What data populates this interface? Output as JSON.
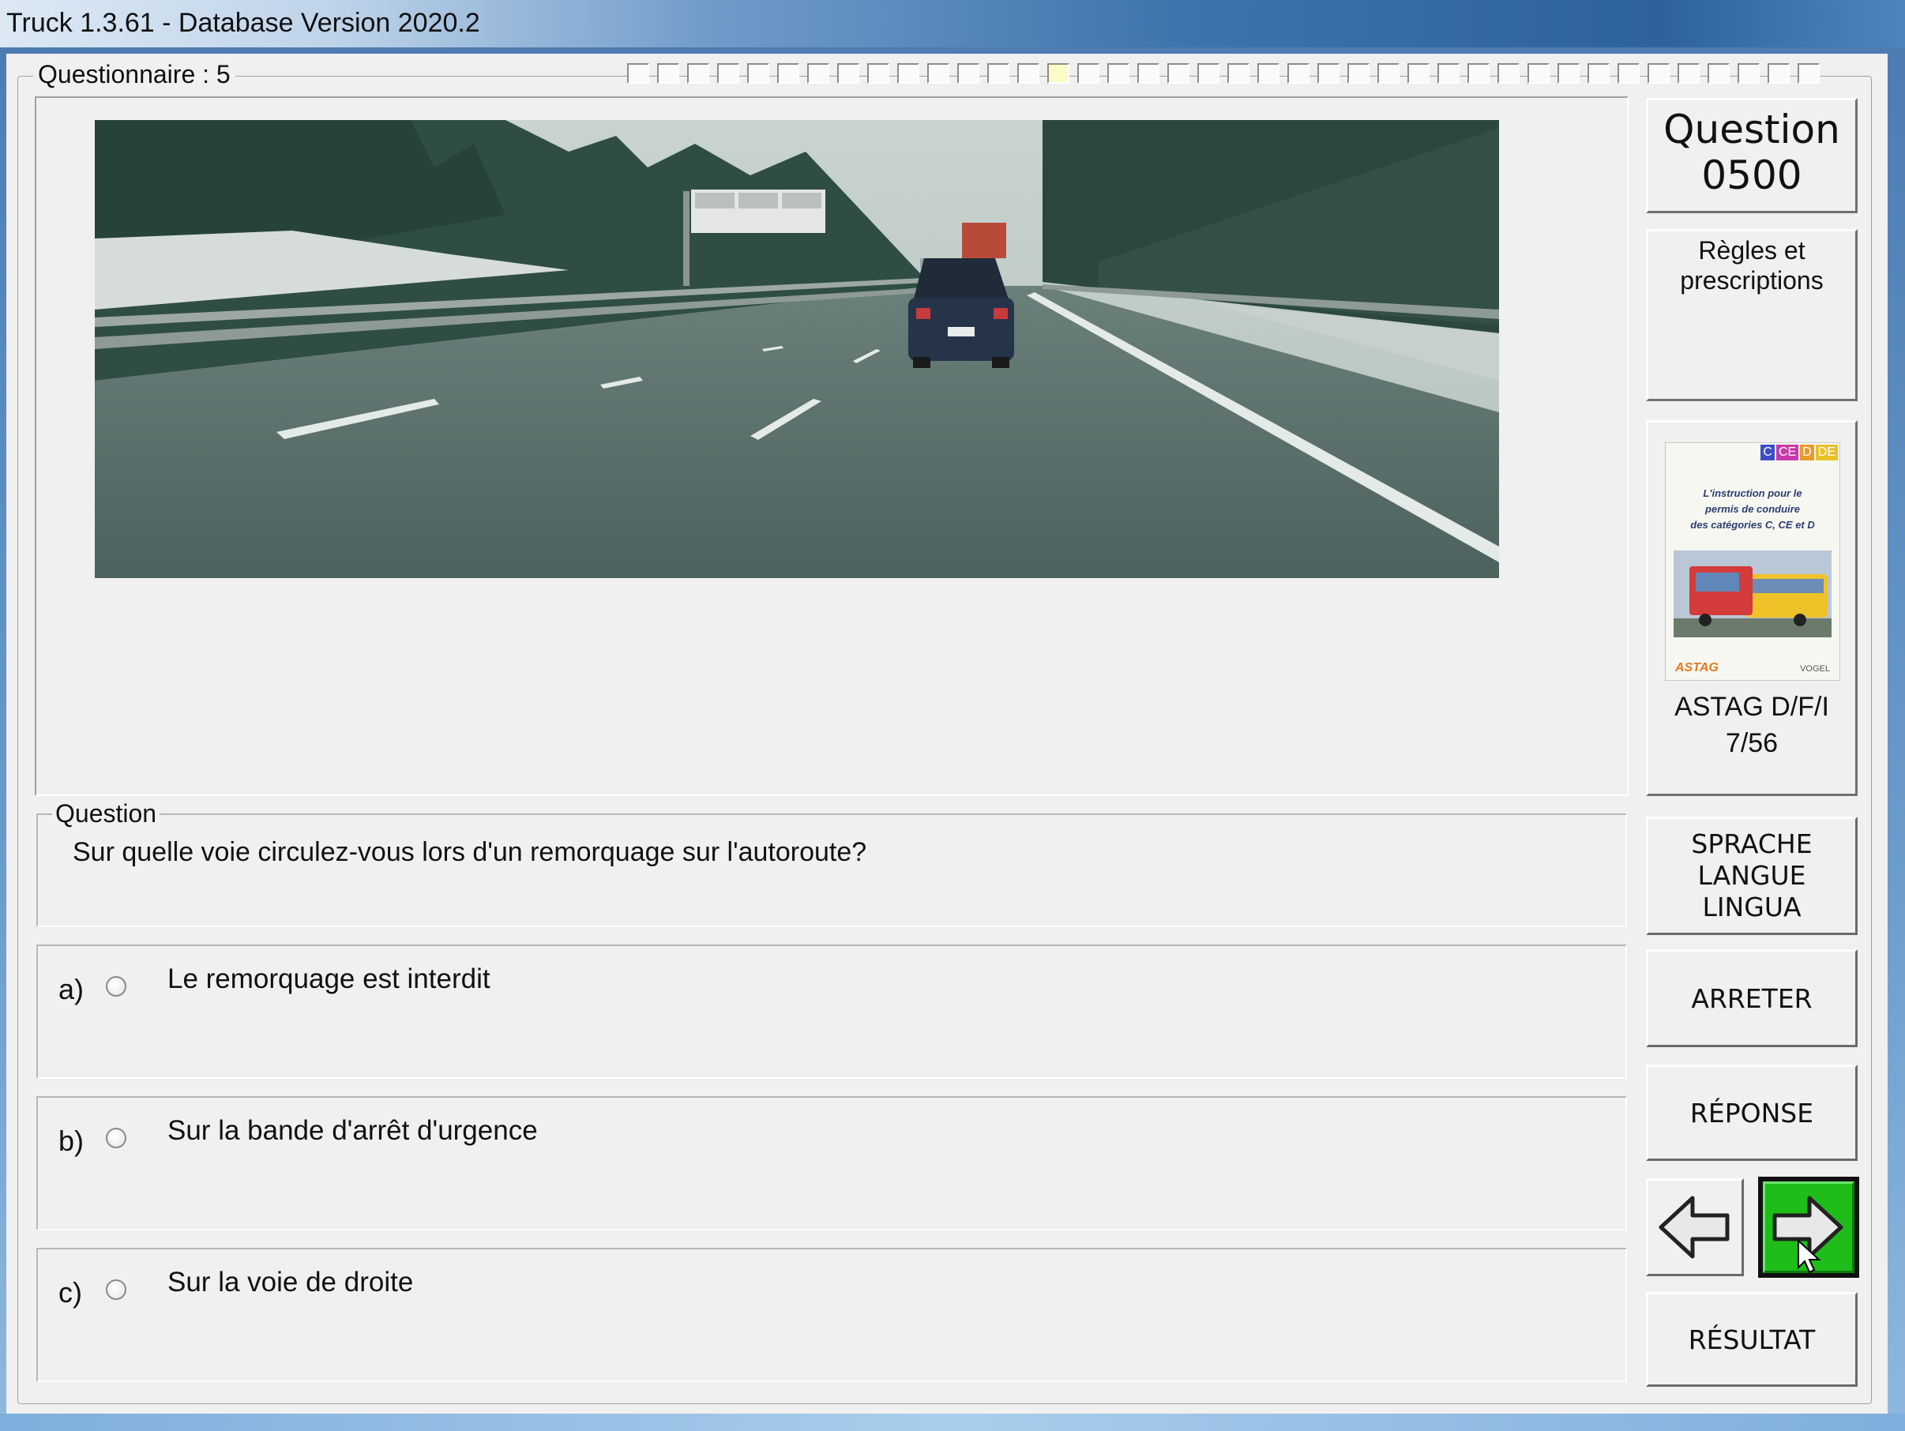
{
  "window": {
    "title": "Truck 1.3.61 - Database Version 2020.2"
  },
  "questionnaire": {
    "label": "Questionnaire : 5",
    "progress_total": 40,
    "progress_current_index": 14
  },
  "question": {
    "group_label": "Question",
    "text": "Sur quelle voie circulez-vous lors d'un remorquage sur l'autoroute?",
    "answers": [
      {
        "letter": "a)",
        "text": "Le remorquage est interdit"
      },
      {
        "letter": "b)",
        "text": "Sur la bande d'arrêt d'urgence"
      },
      {
        "letter": "c)",
        "text": "Sur la voie de droite"
      }
    ]
  },
  "sidebar": {
    "question_label": "Question",
    "question_number": "0500",
    "category_line1": "Règles et",
    "category_line2": "prescriptions",
    "book_caption_line1": "ASTAG D/F/I",
    "book_caption_line2": "7/56",
    "book_cover": {
      "badges": [
        "C",
        "CE",
        "D",
        "DE"
      ],
      "line1": "L'instruction pour le",
      "line2": "permis de conduire",
      "line3": "des catégories C, CE et D",
      "logo_left": "ASTAG",
      "logo_right": "VOGEL"
    },
    "language_btn": [
      "SPRACHE",
      "LANGUE",
      "LINGUA"
    ],
    "stop_btn": "ARRETER",
    "answer_btn": "RÉPONSE",
    "result_btn": "RÉSULTAT"
  },
  "colors": {
    "next_button": "#1fbd1a",
    "window_bg": "#f0f0f0",
    "titlebar_accent": "#2f629c"
  }
}
